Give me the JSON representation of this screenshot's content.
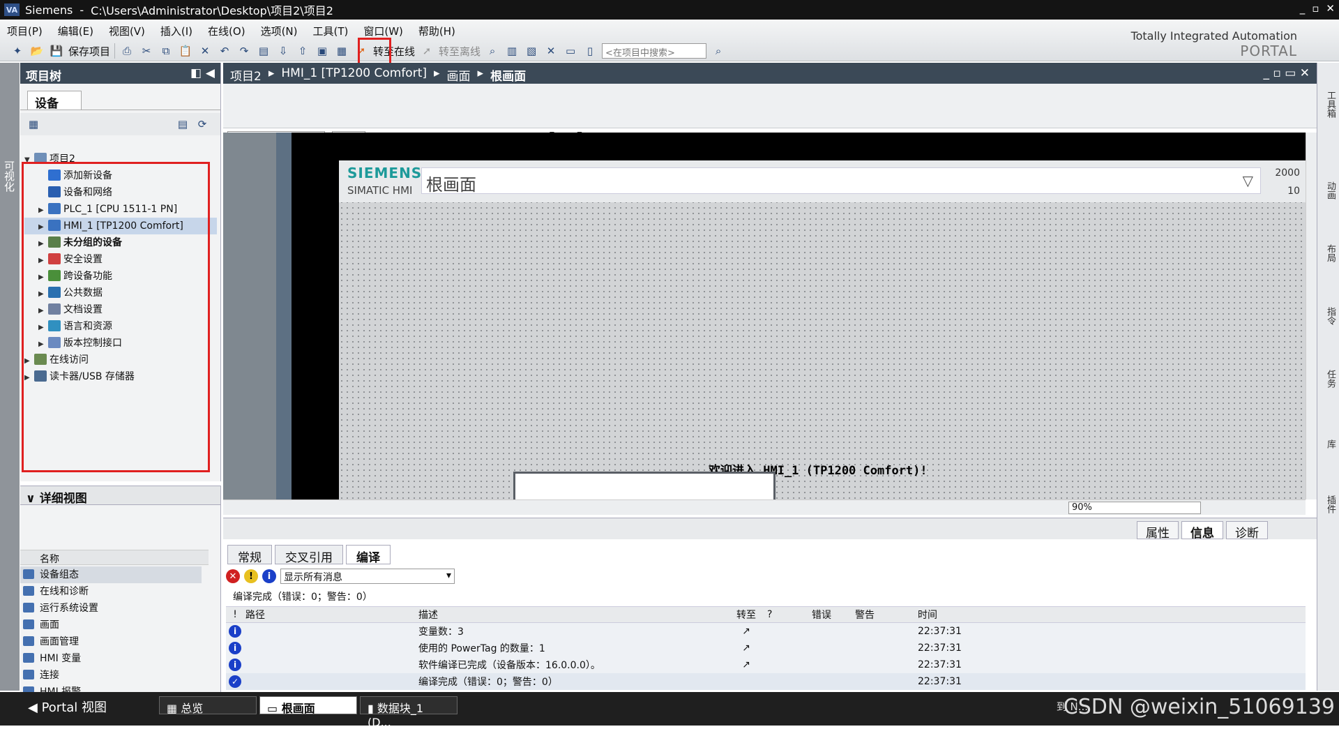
{
  "window": {
    "app": "Siemens",
    "path": "C:\\Users\\Administrator\\Desktop\\项目2\\项目2"
  },
  "menu": [
    "项目(P)",
    "编辑(E)",
    "视图(V)",
    "插入(I)",
    "在线(O)",
    "选项(N)",
    "工具(T)",
    "窗口(W)",
    "帮助(H)"
  ],
  "toolbar": {
    "save_label": "保存项目",
    "go_online": "转至在线",
    "go_offline": "转至离线",
    "search_placeholder": "<在项目中搜索>"
  },
  "brand": {
    "line1": "Totally Integrated Automation",
    "line2": "PORTAL"
  },
  "left_strip_label": "可视化",
  "project_tree": {
    "title": "项目树",
    "tab": "设备",
    "items": [
      {
        "label": "项目2",
        "level": 0,
        "arrow": "▼"
      },
      {
        "label": "添加新设备",
        "level": 1,
        "arrow": ""
      },
      {
        "label": "设备和网络",
        "level": 1,
        "arrow": ""
      },
      {
        "label": "PLC_1 [CPU 1511-1 PN]",
        "level": 1,
        "arrow": "▶"
      },
      {
        "label": "HMI_1 [TP1200 Comfort]",
        "level": 1,
        "arrow": "▶",
        "selected": true
      },
      {
        "label": "未分组的设备",
        "level": 1,
        "arrow": "▶",
        "bold": true
      },
      {
        "label": "安全设置",
        "level": 1,
        "arrow": "▶"
      },
      {
        "label": "跨设备功能",
        "level": 1,
        "arrow": "▶"
      },
      {
        "label": "公共数据",
        "level": 1,
        "arrow": "▶"
      },
      {
        "label": "文档设置",
        "level": 1,
        "arrow": "▶"
      },
      {
        "label": "语言和资源",
        "level": 1,
        "arrow": "▶"
      },
      {
        "label": "版本控制接口",
        "level": 1,
        "arrow": "▶"
      },
      {
        "label": "在线访问",
        "level": 0,
        "arrow": "▶"
      },
      {
        "label": "读卡器/USB 存储器",
        "level": 0,
        "arrow": "▶"
      }
    ]
  },
  "detail_view": {
    "title": "详细视图",
    "column": "名称",
    "items": [
      "设备组态",
      "在线和诊断",
      "运行系统设置",
      "画面",
      "画面管理",
      "HMI 变量",
      "连接",
      "HMI 报警"
    ]
  },
  "breadcrumb": [
    "项目2",
    "HMI_1 [TP1200 Comfort]",
    "画面",
    "根画面"
  ],
  "hmi": {
    "brand": "SIEMENS",
    "model": "SIMATIC HMI",
    "screen_title": "根画面",
    "date": "2000",
    "time": "10",
    "welcome": "欢迎进入 HMI_1 (TP1200 Comfort)!"
  },
  "zoom": "90%",
  "right_strip": [
    "工具箱",
    "动画",
    "布局",
    "指令",
    "任务",
    "库",
    "插件"
  ],
  "inspector": {
    "top_tabs": [
      "属性",
      "信息",
      "诊断"
    ],
    "sub_tabs": [
      "常规",
      "交叉引用",
      "编译"
    ],
    "filter": "显示所有消息",
    "summary": "编译完成（错误：0；警告：0）",
    "columns": [
      "!",
      "路径",
      "描述",
      "转至",
      "?",
      "错误",
      "警告",
      "时间"
    ],
    "rows": [
      {
        "desc": "变量数：3",
        "time": "22:37:31",
        "goto": "↗"
      },
      {
        "desc": "使用的 PowerTag 的数量：1",
        "time": "22:37:31",
        "goto": "↗"
      },
      {
        "desc": "软件编译已完成（设备版本：16.0.0.0）。",
        "time": "22:37:31",
        "goto": "↗"
      },
      {
        "desc": "编译完成（错误：0；警告：0）",
        "time": "22:37:31",
        "goto": ""
      }
    ]
  },
  "statusbar": {
    "portal_view": "Portal 视图",
    "tabs": [
      "总览",
      "根画面",
      "数据块_1 (D..."
    ],
    "status_text": "到 N...",
    "watermark": "CSDN @weixin_51069139"
  },
  "colors": {
    "header": "#3b4957",
    "accent_red": "#e02020",
    "siemens_teal": "#1d9a9a",
    "info_blue": "#1a3fc8"
  }
}
